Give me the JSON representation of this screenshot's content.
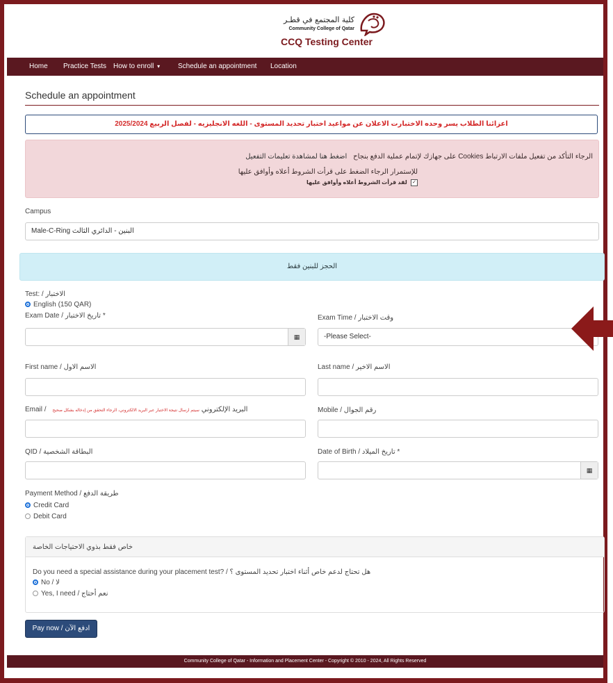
{
  "header": {
    "logo_arabic": "كلية المجتمع في قطـر",
    "logo_english": "Community College of Qatar",
    "brand_title": "CCQ Testing Center"
  },
  "nav": {
    "home": "Home",
    "practice_tests": "Practice Tests",
    "how_to_enroll": "How to enroll",
    "how_to_enroll_caret": "▾",
    "schedule": "Schedule an appointment",
    "location": "Location"
  },
  "page": {
    "title": "Schedule an appointment",
    "announcement": "اعزائنا الطلاب يسر وحده الاختبارت الاعلان عن مواعيد اختبار تحديد المستوى - اللغه الانجليزيه - لفصل الربيع 2025/2024"
  },
  "alert": {
    "cookies_text": "الرجاء التأكد من تفعيل ملفات الارتباط Cookies على جهازك لإتمام عملية الدفع بنجاح",
    "cookies_link": "اضغط هنا لمشاهدة تعليمات التفعيل",
    "continue_text": "للإستمرار الرجاء الضغط على قرأت الشروط أعلاه وأوافق عليها",
    "agree_label": "لقد قرأت الشروط أعلاه وأوافق عليها",
    "agree_checked": true
  },
  "campus": {
    "label": "Campus",
    "value": "Male-C-Ring البنين - الدائري الثالث"
  },
  "info_banner": "الحجز للبنين فقط",
  "test": {
    "label": "Test: / الاختبار",
    "option": "English (150 QAR)"
  },
  "exam_date": {
    "label": "Exam Date / تاريخ الاختبار *",
    "value": ""
  },
  "exam_time": {
    "label": "Exam Time / وقت الاختبار",
    "selected": "-Please Select-"
  },
  "first_name": {
    "label": "First name / الاسم الاول",
    "value": ""
  },
  "last_name": {
    "label": "Last name / الاسم الاخير",
    "value": ""
  },
  "email": {
    "label": "Email / البريد الإلكتروني",
    "note": "سيتم ارسال نتيجة الاختبار عبر البريد الالكتروني، الرجاء التحقق من إدخاله بشكل صحيح",
    "value": ""
  },
  "mobile": {
    "label": "Mobile / رقم الجوال",
    "value": ""
  },
  "qid": {
    "label": "QID / البطاقة الشخصية",
    "value": ""
  },
  "dob": {
    "label": "Date of Birth / تاريخ الميلاد *",
    "value": ""
  },
  "payment": {
    "label": "Payment Method / طريقة الدفع",
    "options": [
      "Credit Card",
      "Debit Card"
    ],
    "selected": "Credit Card"
  },
  "special": {
    "heading": "خاص فقط بذوي الاحتياجات الخاصة",
    "question": "Do you need a special assistance during your placement test? / هل تحتاج لدعم خاص أثناء اختبار تحديد المستوى ؟",
    "options": [
      "No / لا",
      "Yes, I need / نعم أحتاج"
    ],
    "selected": "No / لا"
  },
  "pay_button": "Pay now / ادفع الآن",
  "footer": "Community College of Qatar - Information and Placement Center - Copyright © 2010 - 2024, All Rights Reserved",
  "colors": {
    "brand_maroon": "#7b1a1e",
    "nav_bg": "#5a1820",
    "button_blue": "#2c4b7a",
    "alert_bg": "#f2d7da",
    "info_bg": "#d1eff7"
  },
  "icons": {
    "calendar": "calendar-icon",
    "arrow": "left-arrow-icon",
    "emblem": "college-emblem-icon"
  }
}
